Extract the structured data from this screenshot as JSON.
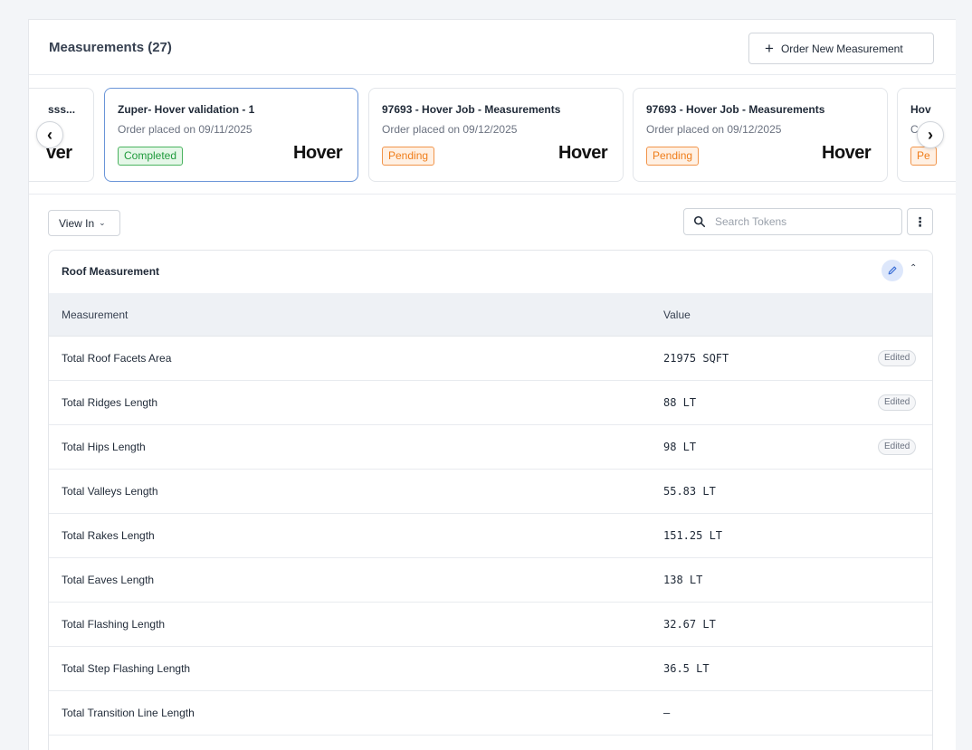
{
  "header": {
    "title": "Measurements (27)",
    "order_button": "Order New Measurement",
    "order_button_icon": "plus-icon"
  },
  "carousel": {
    "prev_icon": "chevron-left-icon",
    "next_icon": "chevron-right-icon",
    "cards": [
      {
        "title": "sss...",
        "subtitle": "",
        "status": "",
        "logo": "ver"
      },
      {
        "title": "Zuper- Hover validation - 1",
        "subtitle": "Order placed on 09/11/2025",
        "status": "Completed",
        "logo": "Hover"
      },
      {
        "title": "97693 - Hover Job - Measurements",
        "subtitle": "Order placed on 09/12/2025",
        "status": "Pending",
        "logo": "Hover"
      },
      {
        "title": "97693 - Hover Job - Measurements",
        "subtitle": "Order placed on 09/12/2025",
        "status": "Pending",
        "logo": "Hover"
      },
      {
        "title": "Hov",
        "subtitle": "C",
        "status": "Pe",
        "logo": ""
      }
    ]
  },
  "toolbar": {
    "view_in": "View In",
    "search_placeholder": "Search Tokens"
  },
  "section": {
    "title": "Roof Measurement",
    "columns": {
      "measurement": "Measurement",
      "value": "Value"
    },
    "edited_label": "Edited",
    "rows": [
      {
        "measurement": "Total Roof Facets Area",
        "value": "21975 SQFT",
        "edited": "Edited"
      },
      {
        "measurement": "Total Ridges Length",
        "value": "88 LT",
        "edited": "Edited"
      },
      {
        "measurement": "Total Hips Length",
        "value": "98 LT",
        "edited": "Edited"
      },
      {
        "measurement": "Total Valleys Length",
        "value": "55.83 LT",
        "edited": ""
      },
      {
        "measurement": "Total Rakes Length",
        "value": "151.25 LT",
        "edited": ""
      },
      {
        "measurement": "Total Eaves Length",
        "value": "138 LT",
        "edited": ""
      },
      {
        "measurement": "Total Flashing Length",
        "value": "32.67 LT",
        "edited": ""
      },
      {
        "measurement": "Total Step Flashing Length",
        "value": "36.5 LT",
        "edited": ""
      },
      {
        "measurement": "Total Transition Line Length",
        "value": "—",
        "edited": ""
      }
    ]
  },
  "colors": {
    "completed": "#1e9a3b",
    "pending": "#ef7d1a",
    "selected_border": "#6a95d8",
    "edit_bg": "#dde7fb"
  }
}
